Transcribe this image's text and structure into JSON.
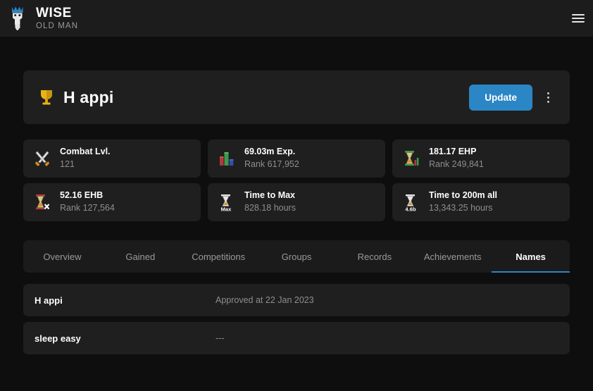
{
  "colors": {
    "page_background": "#0e0e0e",
    "topbar_background": "#1c1c1c",
    "card_background": "#1f1f1f",
    "accent_blue": "#2b86c5",
    "muted_text": "#8e8e8e"
  },
  "topbar": {
    "logo_icon": "wise-old-man-logo-icon",
    "brand_title": "WISE",
    "brand_subtitle": "OLD MAN",
    "menu_icon": "hamburger-menu-icon"
  },
  "profile": {
    "title_icon": "trophy-icon",
    "title": "H appi",
    "update_label": "Update",
    "more_icon": "kebab-menu-icon"
  },
  "stats": [
    {
      "icon": "crossed-swords-icon",
      "label": "Combat Lvl.",
      "value": "121"
    },
    {
      "icon": "bar-chart-icon",
      "label": "69.03m Exp.",
      "value": "Rank 617,952"
    },
    {
      "icon": "hourglass-ehp-icon",
      "label": "181.17 EHP",
      "value": "Rank 249,841"
    },
    {
      "icon": "hourglass-ehb-icon",
      "label": "52.16 EHB",
      "value": "Rank 127,564"
    },
    {
      "icon": "hourglass-max-icon",
      "label": "Time to Max",
      "value": "828.18 hours"
    },
    {
      "icon": "hourglass-200m-icon",
      "label": "Time to 200m all",
      "value": "13,343.25 hours"
    }
  ],
  "tabs": [
    {
      "label": "Overview",
      "active": false
    },
    {
      "label": "Gained",
      "active": false
    },
    {
      "label": "Competitions",
      "active": false
    },
    {
      "label": "Groups",
      "active": false
    },
    {
      "label": "Records",
      "active": false
    },
    {
      "label": "Achievements",
      "active": false
    },
    {
      "label": "Names",
      "active": true
    }
  ],
  "names": [
    {
      "name": "H appi",
      "status": "Approved at 22 Jan 2023"
    },
    {
      "name": "sleep easy",
      "status": "---"
    }
  ]
}
